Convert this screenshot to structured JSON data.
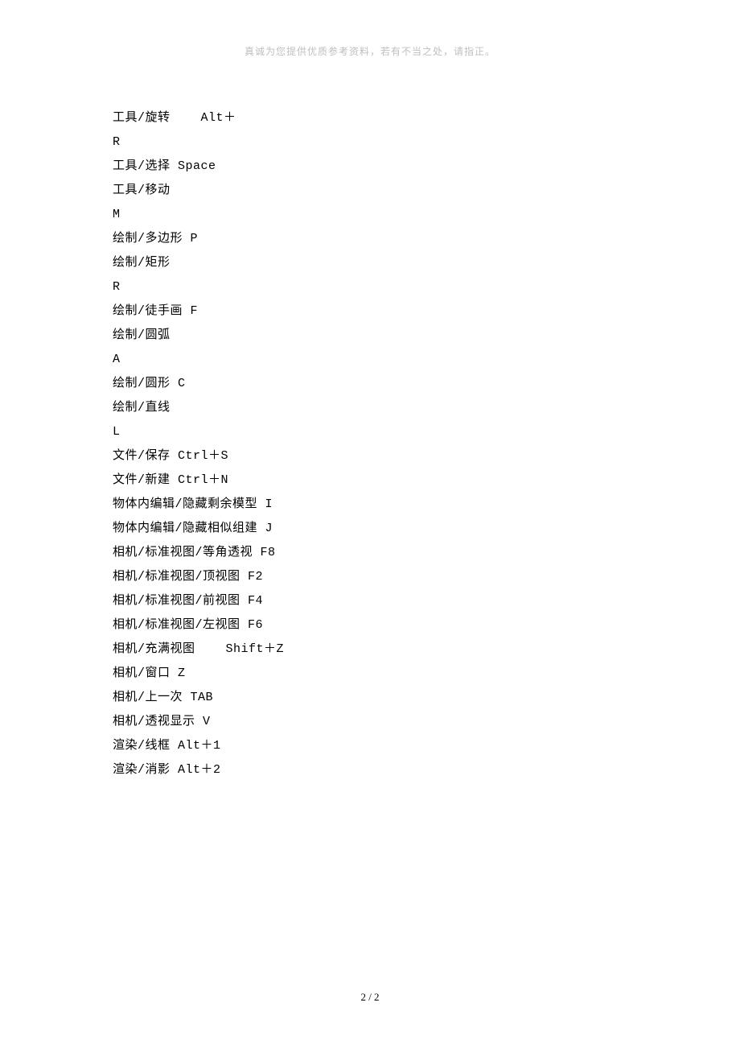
{
  "header": "真诚为您提供优质参考资料，若有不当之处，请指正。",
  "lines": [
    "工具/旋转    Alt＋",
    "R",
    "工具/选择 Space",
    "工具/移动",
    "M",
    "绘制/多边形 P",
    "绘制/矩形",
    "R",
    "绘制/徒手画 F",
    "绘制/圆弧",
    "A",
    "绘制/圆形 C",
    "绘制/直线",
    "L",
    "文件/保存 Ctrl＋S",
    "文件/新建 Ctrl＋N",
    "物体内编辑/隐藏剩余模型 I",
    "物体内编辑/隐藏相似组建 J",
    "相机/标准视图/等角透视 F8",
    "相机/标准视图/顶视图 F2",
    "相机/标准视图/前视图 F4",
    "相机/标准视图/左视图 F6",
    "相机/充满视图    Shift＋Z",
    "相机/窗口 Z",
    "相机/上一次 TAB",
    "相机/透视显示 V",
    "渲染/线框 Alt＋1",
    "渲染/消影 Alt＋2"
  ],
  "footer": "2 / 2"
}
